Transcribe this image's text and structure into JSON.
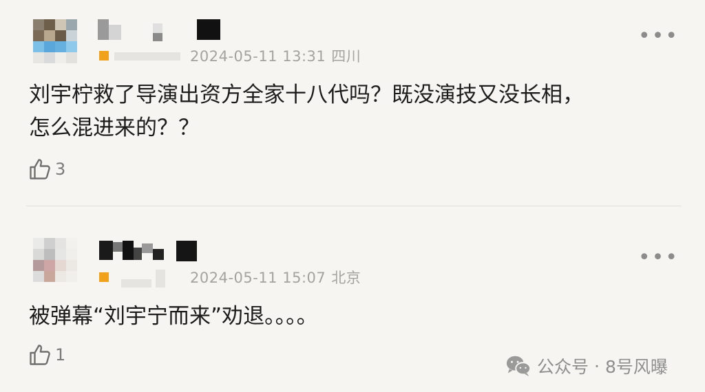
{
  "comments": [
    {
      "timestamp": "2024-05-11 13:31",
      "location": "四川",
      "text_line1": "刘宇柠救了导演出资方全家十八代吗？既没演技又没长相，",
      "text_line2": "怎么混进来的？？",
      "likes": "3",
      "more_icon": "more-dots-icon",
      "like_icon": "thumbs-up-icon"
    },
    {
      "timestamp": "2024-05-11 15:07",
      "location": "北京",
      "text_line1": "被弹幕“刘宇宁而来”劝退。。。。",
      "likes": "1",
      "more_icon": "more-dots-icon",
      "like_icon": "thumbs-up-icon"
    }
  ],
  "watermark": {
    "platform": "公众号",
    "separator": "·",
    "account": "8号风曝",
    "icon": "wechat-icon"
  },
  "colors": {
    "background": "#f6f5f1",
    "level_badge": "#f1a21c",
    "meta_text": "#a5a39f"
  }
}
